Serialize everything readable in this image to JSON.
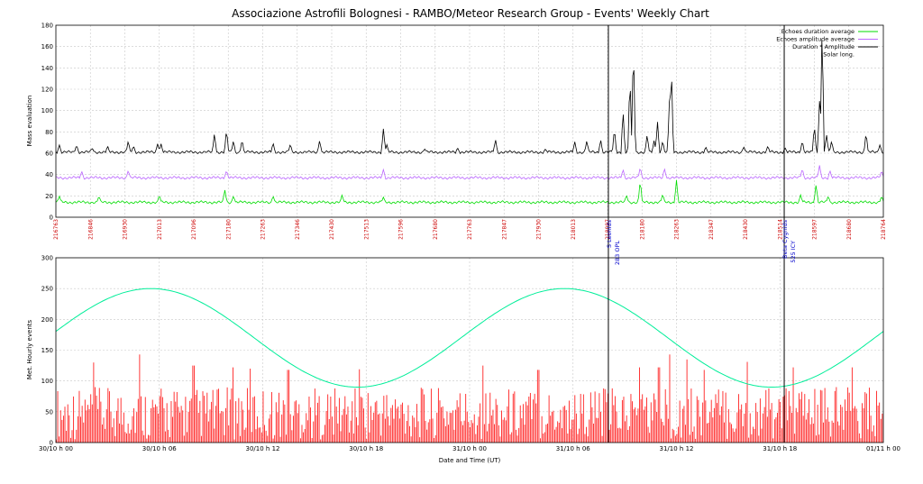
{
  "chart_data": [
    {
      "type": "line",
      "panel": "top",
      "title": "Associazione Astrofili Bolognesi - RAMBO/Meteor Research Group - Events' Weekly Chart",
      "ylabel": "Mass evaluation",
      "ylim": [
        0,
        180
      ],
      "yticks": [
        0,
        20,
        40,
        60,
        80,
        100,
        120,
        140,
        160,
        180
      ],
      "grid": true,
      "legend_position": "top-right",
      "legend": [
        {
          "label": "Echoes duration average",
          "color": "#00dd00"
        },
        {
          "label": "Echoes amplitude average",
          "color": "#bb66ff"
        },
        {
          "label": "Duration * Amplitude",
          "color": "#000000"
        },
        {
          "label": "Solar long.",
          "color": "#cc0000"
        }
      ],
      "series": [
        {
          "name": "Echoes duration average",
          "color": "#00dd00",
          "baseline": 14,
          "peaks": [
            [
              0.2,
              20
            ],
            [
              2.5,
              20
            ],
            [
              6.0,
              21
            ],
            [
              9.8,
              26
            ],
            [
              10.3,
              20
            ],
            [
              12.6,
              20
            ],
            [
              16.6,
              21
            ],
            [
              19.0,
              19
            ],
            [
              33.1,
              21
            ],
            [
              33.9,
              35
            ],
            [
              35.2,
              22
            ],
            [
              36.0,
              35
            ],
            [
              43.2,
              21
            ],
            [
              44.1,
              31
            ],
            [
              44.8,
              20
            ],
            [
              47.9,
              20
            ]
          ]
        },
        {
          "name": "Echoes amplitude average",
          "color": "#bb66ff",
          "baseline": 37,
          "peaks": [
            [
              1.5,
              43
            ],
            [
              4.2,
              44
            ],
            [
              9.9,
              44
            ],
            [
              19.0,
              45
            ],
            [
              32.9,
              45
            ],
            [
              33.9,
              47
            ],
            [
              35.3,
              46
            ],
            [
              43.3,
              46
            ],
            [
              44.3,
              49
            ],
            [
              44.9,
              44
            ],
            [
              47.9,
              44
            ]
          ]
        },
        {
          "name": "Duration * Amplitude",
          "color": "#000000",
          "baseline": 61,
          "peaks": [
            [
              0.2,
              68
            ],
            [
              1.2,
              68
            ],
            [
              2.1,
              65
            ],
            [
              3.0,
              67
            ],
            [
              4.2,
              72
            ],
            [
              4.5,
              67
            ],
            [
              5.9,
              69
            ],
            [
              6.1,
              69
            ],
            [
              9.2,
              79
            ],
            [
              9.9,
              83
            ],
            [
              10.3,
              72
            ],
            [
              10.8,
              73
            ],
            [
              12.6,
              70
            ],
            [
              13.6,
              69
            ],
            [
              15.3,
              72
            ],
            [
              19.0,
              84
            ],
            [
              19.2,
              68
            ],
            [
              21.4,
              64
            ],
            [
              23.3,
              65
            ],
            [
              25.5,
              73
            ],
            [
              28.4,
              64
            ],
            [
              30.1,
              71
            ],
            [
              30.8,
              72
            ],
            [
              31.6,
              73
            ],
            [
              32.4,
              84
            ],
            [
              32.9,
              101
            ],
            [
              33.3,
              134
            ],
            [
              33.5,
              165
            ],
            [
              34.3,
              78
            ],
            [
              34.7,
              72
            ],
            [
              34.9,
              90
            ],
            [
              35.2,
              72
            ],
            [
              35.6,
              113
            ],
            [
              35.7,
              145
            ],
            [
              37.7,
              66
            ],
            [
              39.9,
              66
            ],
            [
              41.3,
              67
            ],
            [
              42.3,
              65
            ],
            [
              43.3,
              72
            ],
            [
              44.0,
              87
            ],
            [
              44.3,
              110
            ],
            [
              44.45,
              182
            ],
            [
              44.7,
              78
            ],
            [
              45.0,
              72
            ],
            [
              47.0,
              80
            ],
            [
              47.8,
              68
            ]
          ]
        }
      ],
      "solar_longitudes": [
        "216763",
        "216846",
        "216930",
        "217013",
        "217096",
        "217180",
        "217263",
        "217346",
        "217430",
        "217513",
        "217596",
        "217680",
        "217763",
        "217847",
        "217930",
        "218013",
        "218097",
        "218180",
        "218263",
        "218347",
        "218430",
        "218514",
        "218597",
        "218680",
        "218764"
      ]
    },
    {
      "type": "bar",
      "panel": "bottom",
      "ylabel": "Met. Hourly events",
      "xlabel": "Date and Time (UT)",
      "ylim": [
        0,
        300
      ],
      "yticks": [
        0,
        50,
        100,
        150,
        200,
        250,
        300
      ],
      "grid": true,
      "x_range_hours": [
        0,
        48
      ],
      "x_ticks": [
        "30/10 h 00",
        "30/10 h 06",
        "30/10 h 12",
        "30/10 h 18",
        "31/10 h 00",
        "31/10 h 06",
        "31/10 h 12",
        "31/10 h 18",
        "01/11 h 00"
      ],
      "series": [
        {
          "name": "Solar long.",
          "color": "#00ee99",
          "type": "sine",
          "mean": 170,
          "amplitude": 80,
          "maxima_hours": [
            5.5,
            29.5
          ]
        },
        {
          "name": "Met. Hourly events",
          "color": "#ff2222",
          "bar_count": 576,
          "bar_interval_minutes": 5,
          "typical_range": [
            5,
            90
          ],
          "peaks": [
            [
              2.2,
              130
            ],
            [
              4.9,
              143
            ],
            [
              8.0,
              125
            ],
            [
              10.3,
              122
            ],
            [
              11.3,
              120
            ],
            [
              13.5,
              118
            ],
            [
              17.6,
              119
            ],
            [
              24.8,
              125
            ],
            [
              28.0,
              118
            ],
            [
              33.9,
              122
            ],
            [
              35.0,
              122
            ],
            [
              35.6,
              143
            ],
            [
              36.6,
              135
            ],
            [
              37.6,
              118
            ],
            [
              40.1,
              131
            ],
            [
              42.8,
              122
            ],
            [
              46.2,
              122
            ]
          ]
        }
      ],
      "shower_markers": [
        {
          "hour": 32.05,
          "label1": "S Leonids",
          "label2": "283 OPL"
        },
        {
          "hour": 42.25,
          "label1": "Beta Cygnids",
          "label2": "525 ICY"
        }
      ]
    }
  ]
}
